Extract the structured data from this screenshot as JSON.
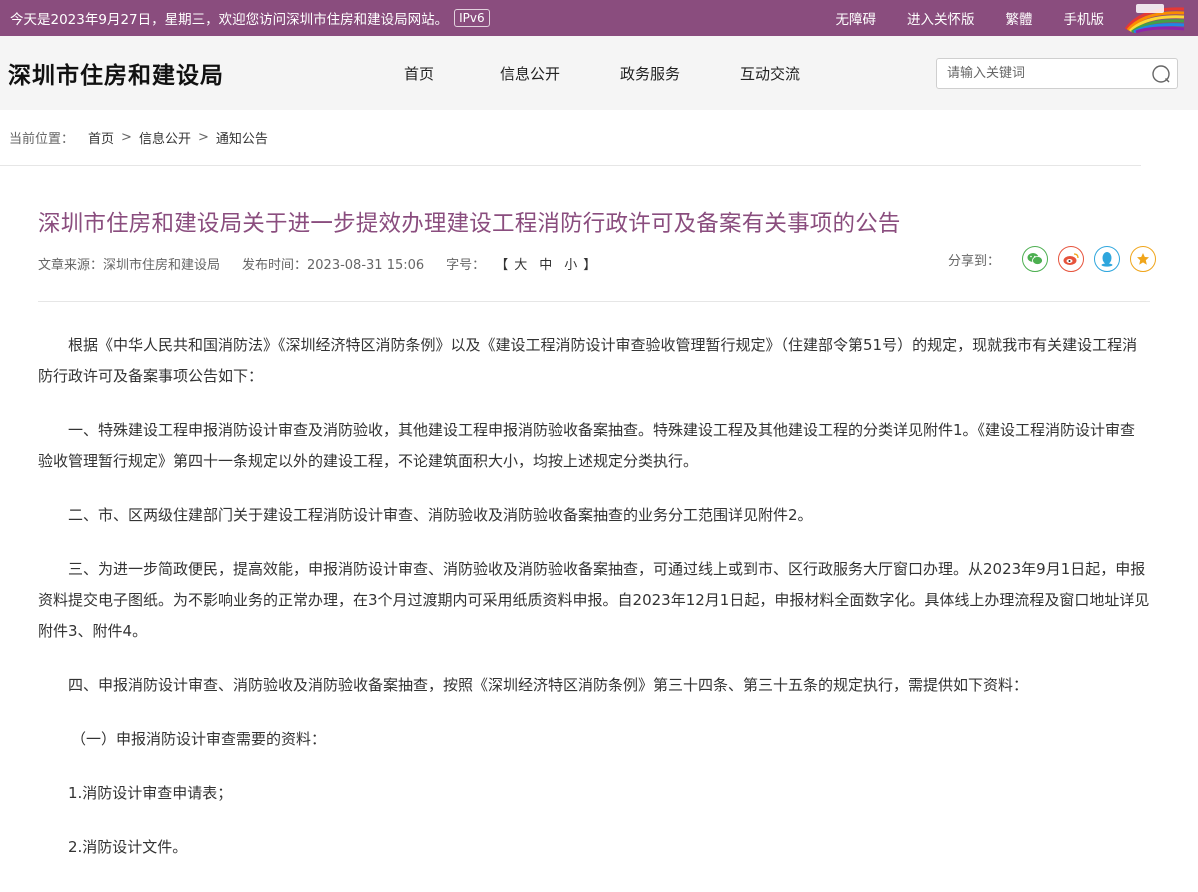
{
  "topbar": {
    "welcome": "今天是2023年9月27日，星期三，欢迎您访问深圳市住房和建设局网站。",
    "ipv6": "IPv6",
    "links": [
      "无障碍",
      "进入关怀版",
      "繁體",
      "手机版"
    ]
  },
  "header": {
    "site_title": "深圳市住房和建设局",
    "nav": [
      "首页",
      "信息公开",
      "政务服务",
      "互动交流"
    ],
    "search_placeholder": "请输入关键词"
  },
  "breadcrumb": {
    "label": "当前位置：",
    "items": [
      "首页",
      "信息公开",
      "通知公告"
    ],
    "separator": ">"
  },
  "article": {
    "title": "深圳市住房和建设局关于进一步提效办理建设工程消防行政许可及备案有关事项的公告",
    "source": "文章来源：深圳市住房和建设局",
    "published": "发布时间：2023-08-31 15:06",
    "font_size_label": "字号：",
    "font_sizes": [
      "大",
      "中",
      "小"
    ],
    "bracket_open": "【",
    "bracket_close": "】",
    "share_label": "分享到：",
    "share_colors": {
      "wechat": "#4caf50",
      "weibo": "#e6533c",
      "qq": "#2ea6dd",
      "favorite": "#f0a51a"
    },
    "paragraphs": [
      "根据《中华人民共和国消防法》《深圳经济特区消防条例》以及《建设工程消防设计审查验收管理暂行规定》（住建部令第51号）的规定，现就我市有关建设工程消防行政许可及备案事项公告如下：",
      "一、特殊建设工程申报消防设计审查及消防验收，其他建设工程申报消防验收备案抽查。特殊建设工程及其他建设工程的分类详见附件1。《建设工程消防设计审查验收管理暂行规定》第四十一条规定以外的建设工程，不论建筑面积大小，均按上述规定分类执行。",
      "二、市、区两级住建部门关于建设工程消防设计审查、消防验收及消防验收备案抽查的业务分工范围详见附件2。",
      "三、为进一步简政便民，提高效能，申报消防设计审查、消防验收及消防验收备案抽查，可通过线上或到市、区行政服务大厅窗口办理。从2023年9月1日起，申报资料提交电子图纸。为不影响业务的正常办理，在3个月过渡期内可采用纸质资料申报。自2023年12月1日起，申报材料全面数字化。具体线上办理流程及窗口地址详见附件3、附件4。",
      "四、申报消防设计审查、消防验收及消防验收备案抽查，按照《深圳经济特区消防条例》第三十四条、第三十五条的规定执行，需提供如下资料：",
      "（一）申报消防设计审查需要的资料：",
      "1.消防设计审查申请表；",
      "2.消防设计文件。"
    ]
  }
}
